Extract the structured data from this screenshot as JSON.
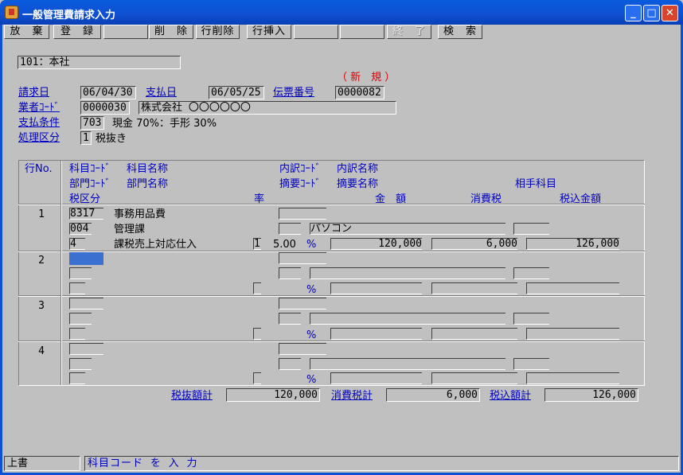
{
  "window": {
    "title": "一般管理費請求入力"
  },
  "toolbar": {
    "keys": [
      "放　棄",
      "登　録",
      "",
      "削　除",
      "行削除",
      "行挿入",
      "",
      "",
      "終　了",
      "検　索"
    ]
  },
  "company": {
    "value": "101：本社"
  },
  "mode": {
    "label": "（ 新　規 ）"
  },
  "header": {
    "invoice_date_label": "請求日",
    "invoice_date": "06/04/30",
    "pay_date_label": "支払日",
    "pay_date": "06/05/25",
    "slip_no_label": "伝票番号",
    "slip_no": "0000082",
    "vendor_label": "業者ｺｰﾄﾞ",
    "vendor_code": "0000030",
    "vendor_name": "株式会社 〇〇〇〇〇〇",
    "terms_label": "支払条件",
    "terms_code": "703",
    "terms_text": "現金 70%：手形 30%",
    "proc_label": "処理区分",
    "proc_code": "1",
    "proc_text": "税抜き"
  },
  "columns": {
    "row_no": "行No.",
    "acct_code": "科目ｺｰﾄﾞ",
    "acct_name": "科目名称",
    "sub_code": "内訳ｺｰﾄﾞ",
    "sub_name": "内訳名称",
    "dept_code": "部門ｺｰﾄﾞ",
    "dept_name": "部門名称",
    "memo_code": "摘要ｺｰﾄﾞ",
    "memo_name": "摘要名称",
    "counter_acct": "相手科目",
    "tax_class": "税区分",
    "rate": "率",
    "amount": "金　額",
    "tax": "消費税",
    "total": "税込金額"
  },
  "rows": [
    {
      "no": "1",
      "acct_code": "8317",
      "acct_name": "事務用品費",
      "dept_code": "004",
      "dept_name": "管理課",
      "memo_name": "パソコン",
      "tax_code": "4",
      "tax_name": "課税売上対応仕入",
      "rate_code": "1",
      "rate": "5.00",
      "pct": "%",
      "amount": "120,000",
      "tax": "6,000",
      "total": "126,000"
    },
    {
      "no": "2",
      "pct": "%"
    },
    {
      "no": "3",
      "pct": "%"
    },
    {
      "no": "4",
      "pct": "%"
    }
  ],
  "totals": {
    "net_label": "税抜額計",
    "net": "120,000",
    "tax_label": "消費税計",
    "tax": "6,000",
    "gross_label": "税込額計",
    "gross": "126,000"
  },
  "status": {
    "mode": "上書",
    "message": "科目コード を 入 力"
  }
}
